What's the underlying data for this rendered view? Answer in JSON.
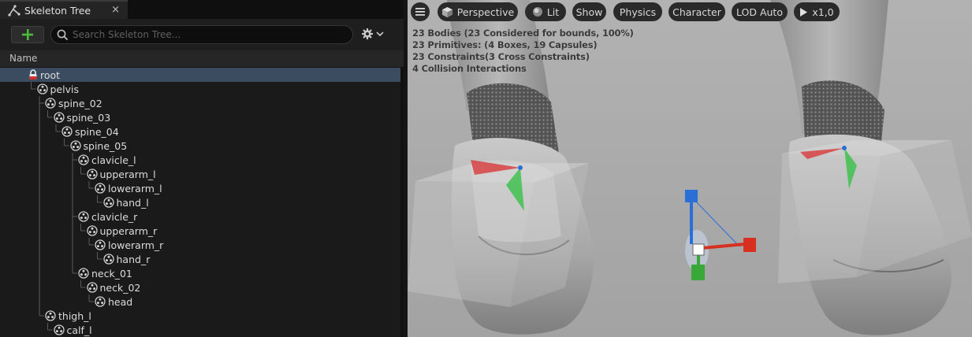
{
  "skeleton_panel": {
    "tab": {
      "title": "Skeleton Tree",
      "icon": "bone-icon",
      "close_glyph": "×"
    },
    "toolbar": {
      "add_icon": "plus-icon",
      "search": {
        "placeholder": "Search Skeleton Tree...",
        "value": ""
      },
      "settings_icon": "gear-icon",
      "dropdown_icon": "chevron-down-icon"
    },
    "column_header": "Name",
    "tree": [
      {
        "label": "root",
        "depth": 0,
        "icon": "lock-icon",
        "selected": true
      },
      {
        "label": "pelvis",
        "depth": 1,
        "icon": "bone-joint-icon"
      },
      {
        "label": "spine_02",
        "depth": 2,
        "icon": "bone-joint-icon"
      },
      {
        "label": "spine_03",
        "depth": 3,
        "icon": "bone-joint-icon"
      },
      {
        "label": "spine_04",
        "depth": 4,
        "icon": "bone-joint-icon"
      },
      {
        "label": "spine_05",
        "depth": 5,
        "icon": "bone-joint-icon"
      },
      {
        "label": "clavicle_l",
        "depth": 6,
        "icon": "bone-joint-icon"
      },
      {
        "label": "upperarm_l",
        "depth": 7,
        "icon": "bone-joint-icon"
      },
      {
        "label": "lowerarm_l",
        "depth": 8,
        "icon": "bone-joint-icon"
      },
      {
        "label": "hand_l",
        "depth": 9,
        "icon": "bone-joint-icon"
      },
      {
        "label": "clavicle_r",
        "depth": 6,
        "icon": "bone-joint-icon"
      },
      {
        "label": "upperarm_r",
        "depth": 7,
        "icon": "bone-joint-icon"
      },
      {
        "label": "lowerarm_r",
        "depth": 8,
        "icon": "bone-joint-icon"
      },
      {
        "label": "hand_r",
        "depth": 9,
        "icon": "bone-joint-icon"
      },
      {
        "label": "neck_01",
        "depth": 6,
        "icon": "bone-joint-icon"
      },
      {
        "label": "neck_02",
        "depth": 7,
        "icon": "bone-joint-icon"
      },
      {
        "label": "head",
        "depth": 8,
        "icon": "bone-joint-icon"
      },
      {
        "label": "thigh_l",
        "depth": 2,
        "icon": "bone-joint-icon"
      },
      {
        "label": "calf_l",
        "depth": 3,
        "icon": "bone-joint-icon"
      }
    ]
  },
  "viewport": {
    "toolbar": {
      "menu_icon": "hamburger-menu-icon",
      "perspective": {
        "label": "Perspective",
        "icon": "cube-icon"
      },
      "lit": {
        "label": "Lit",
        "icon": "lit-sphere-icon"
      },
      "show": {
        "label": "Show"
      },
      "physics": {
        "label": "Physics"
      },
      "character": {
        "label": "Character"
      },
      "lod": {
        "label": "LOD Auto"
      },
      "play": {
        "label": "x1,0",
        "icon": "play-icon"
      }
    },
    "stats": [
      "23 Bodies (23 Considered for bounds, 100%)",
      "23 Primitives: (4 Boxes, 19 Capsules)",
      "23 Constraints(3 Cross Constraints)",
      "4 Collision Interactions"
    ]
  },
  "colors": {
    "selection": "#3b4c60",
    "add_green": "#4cbb3c",
    "gizmo_x": "#d83020",
    "gizmo_y": "#38a838",
    "gizmo_z": "#2a6fd8"
  }
}
